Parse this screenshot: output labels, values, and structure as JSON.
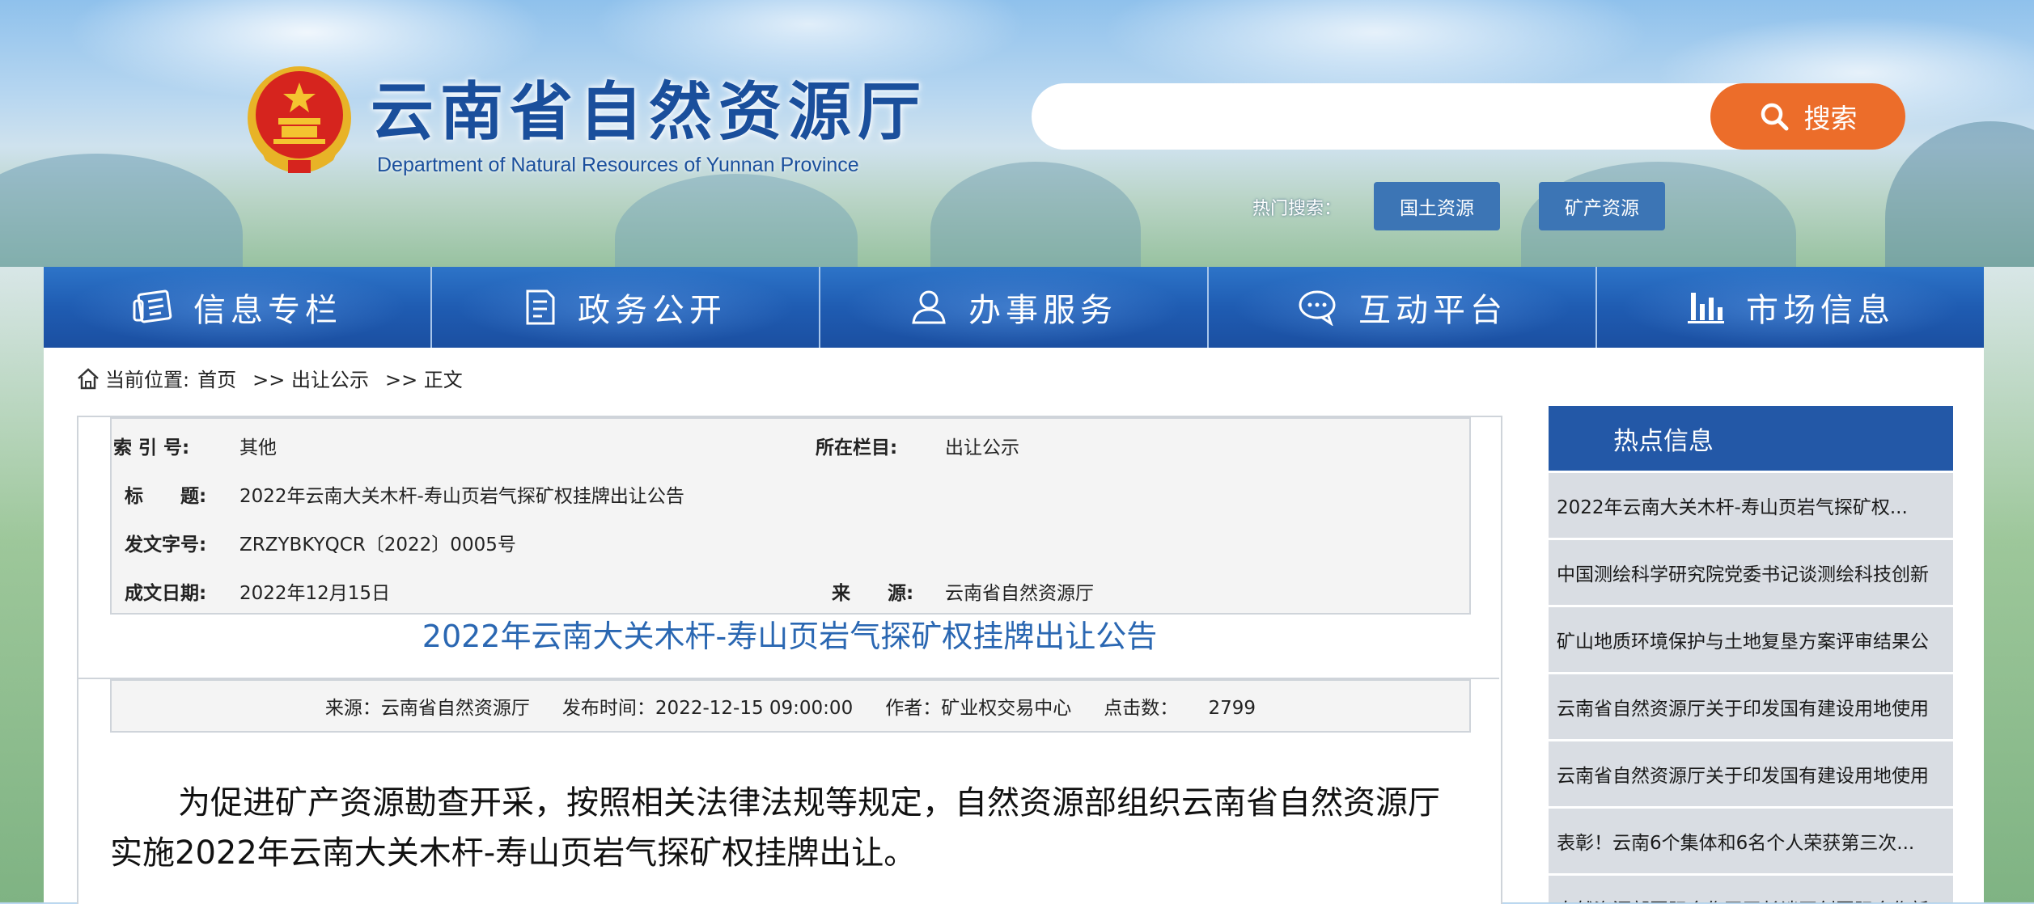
{
  "header": {
    "title_cn": "云南省自然资源厅",
    "title_en": "Department of Natural Resources of Yunnan Province",
    "search": {
      "placeholder": "",
      "button_label": "搜索",
      "hot_label": "热门搜索：",
      "hot_tags": [
        "国土资源",
        "矿产资源"
      ]
    }
  },
  "nav": {
    "items": [
      {
        "label": "信息专栏",
        "icon": "newspaper-icon"
      },
      {
        "label": "政务公开",
        "icon": "document-icon"
      },
      {
        "label": "办事服务",
        "icon": "user-icon"
      },
      {
        "label": "互动平台",
        "icon": "chat-icon"
      },
      {
        "label": "市场信息",
        "icon": "bar-chart-icon"
      }
    ]
  },
  "breadcrumb": {
    "prefix": "当前位置:",
    "items": [
      "首页",
      ">> 出让公示",
      ">> 正文"
    ]
  },
  "meta": {
    "index_label": "索 引 号:",
    "index_value": "其他",
    "column_label": "所在栏目:",
    "column_value": "出让公示",
    "title_label": "标　　题:",
    "title_value": "2022年云南大关木杆-寿山页岩气探矿权挂牌出让公告",
    "docno_label": "发文字号:",
    "docno_value": "ZRZYBKYQCR〔2022〕0005号",
    "date_label": "成文日期:",
    "date_value": "2022年12月15日",
    "source_label": "来　　源:",
    "source_value": "云南省自然资源厅"
  },
  "article": {
    "title": "2022年云南大关木杆-寿山页岩气探矿权挂牌出让公告",
    "info": {
      "source": "来源：云南省自然资源厅",
      "publish_time": "发布时间：2022-12-15 09:00:00",
      "author": "作者：矿业权交易中心",
      "clicks_label": "点击数：",
      "clicks_value": "2799"
    },
    "body": "为促进矿产资源勘查开采，按照相关法律法规等规定，自然资源部组织云南省自然资源厅实施2022年云南大关木杆-寿山页岩气探矿权挂牌出让。"
  },
  "sidebar": {
    "title": "热点信息",
    "items": [
      "2022年云南大关木杆-寿山页岩气探矿权...",
      "中国测绘科学研究院党委书记谈测绘科技创新",
      "矿山地质环境保护与土地复垦方案评审结果公",
      "云南省自然资源厅关于印发国有建设用地使用",
      "云南省自然资源厅关于印发国有建设用地使用",
      "表彰！云南6个集体和6名个人荣获第三次...",
      "自然资源部国际合作司司长谈开创国际合作新"
    ]
  },
  "colors": {
    "nav_blue": "#1f5cb2",
    "accent_orange": "#ec6d2a",
    "title_blue": "#2a67b2",
    "sidebar_header": "#2358a7"
  }
}
